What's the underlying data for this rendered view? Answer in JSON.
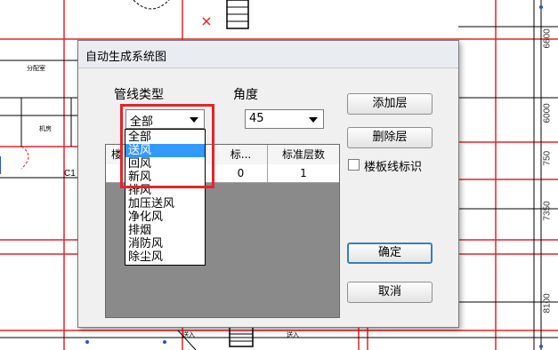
{
  "dialog": {
    "title": "自动生成系统图",
    "pipe_type": {
      "label": "管线类型",
      "selected": "全部",
      "options": [
        "全部",
        "送风",
        "回风",
        "新风",
        "排风",
        "加压送风",
        "净化风",
        "排烟",
        "消防风",
        "除尘风"
      ],
      "highlighted": "送风"
    },
    "angle": {
      "label": "角度",
      "value": "45"
    },
    "table": {
      "headers": [
        "楼",
        "标...",
        "标准层数"
      ],
      "row": [
        "",
        "0",
        "1"
      ]
    },
    "buttons": {
      "add_layer": "添加层",
      "delete_layer": "删除层",
      "ok": "确定",
      "cancel": "取消"
    },
    "checkbox": {
      "label": "楼板线标识",
      "checked": false
    }
  },
  "cad_background": {
    "dimensions": [
      "6600",
      "6000",
      "750",
      "7350",
      "8100"
    ],
    "labels": [
      "C1",
      "分配室",
      "机房",
      "送入",
      "送入"
    ]
  },
  "colors": {
    "highlight": "#3399ff",
    "annotation_red": "#e5232b",
    "default_button_border": "#3c7fb1"
  }
}
